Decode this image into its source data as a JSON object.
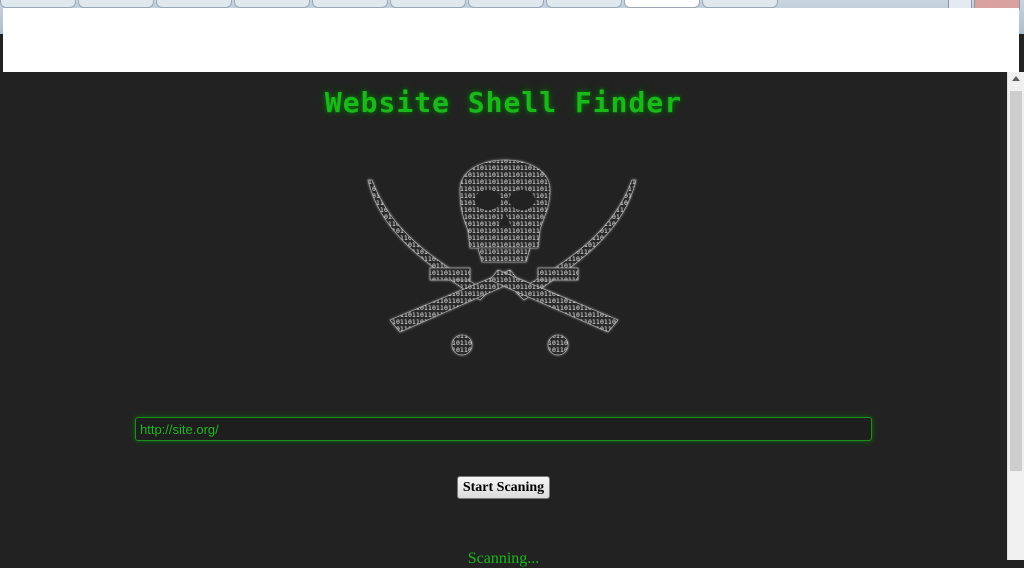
{
  "header": {
    "title": "Website Shell Finder"
  },
  "logo": {
    "icon": "skull-and-crossed-swords-icon",
    "glyphs": "0110100101101001101001011010"
  },
  "form": {
    "url_value": "http://site.org/",
    "scan_label": "Start Scaning"
  },
  "status": {
    "text": "Scanning..."
  },
  "colors": {
    "background": "#222222",
    "accent_green": "#1bb81b",
    "logo_white": "#e8e8e8"
  }
}
